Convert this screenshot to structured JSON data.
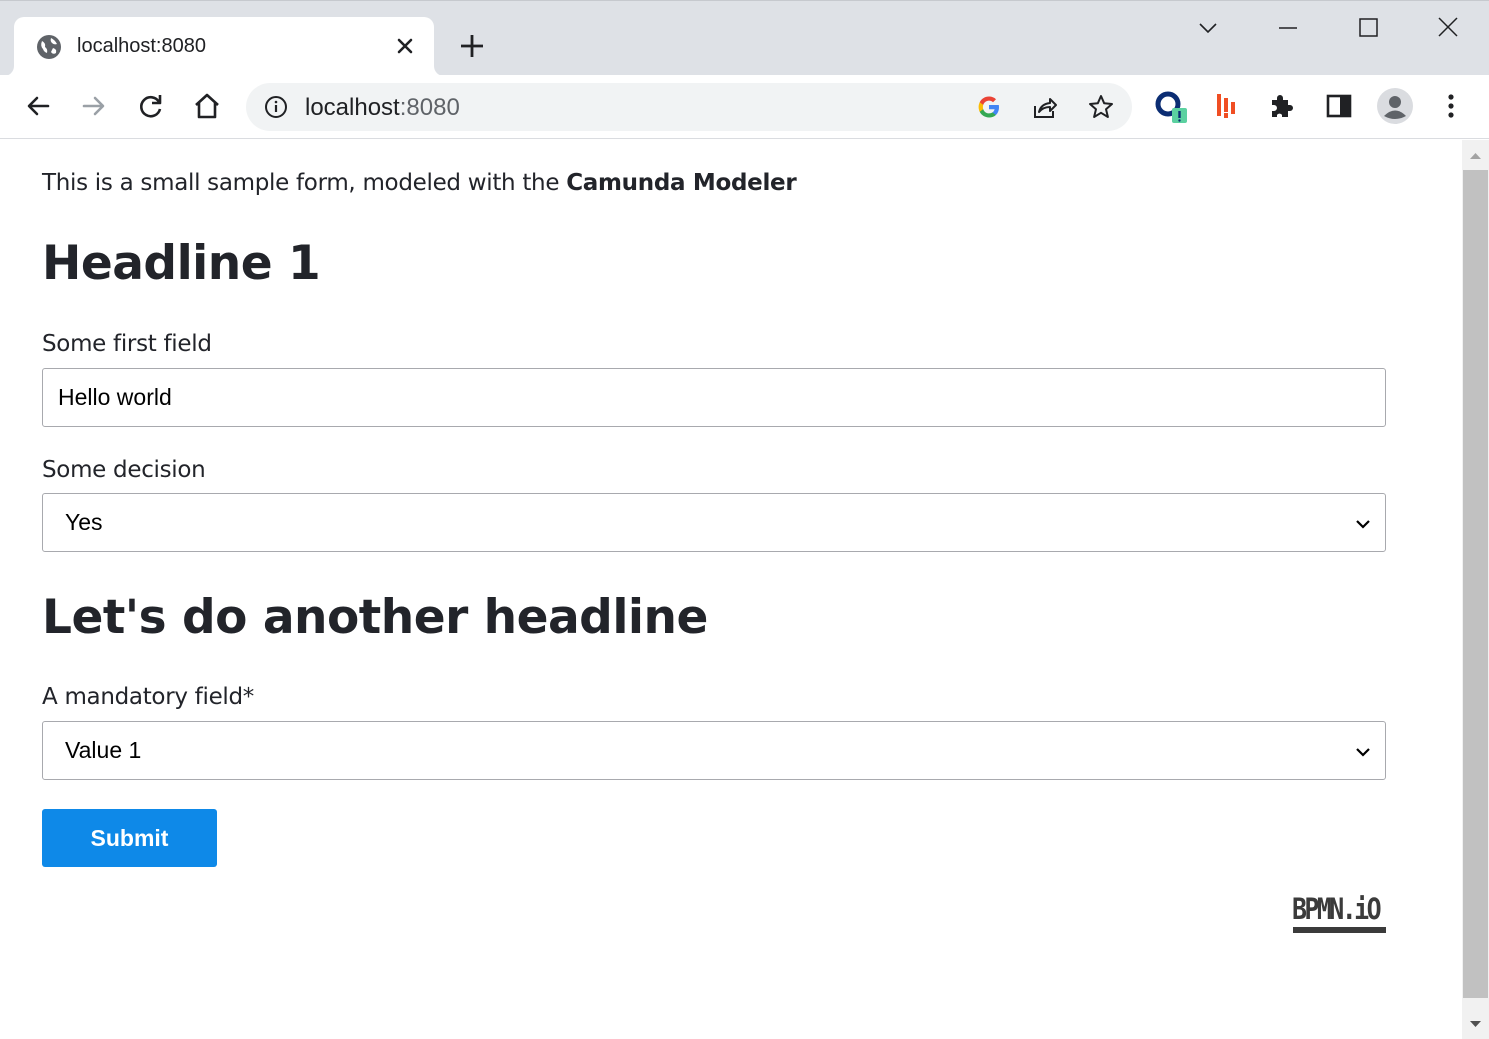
{
  "browser": {
    "tab": {
      "title": "localhost:8080",
      "favicon": "globe-icon"
    },
    "address": {
      "host": "localhost",
      "port": ":8080"
    },
    "icons": {
      "back": "arrow-left-icon",
      "forward": "arrow-right-icon",
      "reload": "reload-icon",
      "home": "home-icon",
      "google": "google-icon",
      "share": "share-icon",
      "bookmark": "star-icon",
      "extensions": "puzzle-icon",
      "sidepanel": "side-panel-icon",
      "profile": "profile-icon",
      "menu": "kebab-menu-icon"
    }
  },
  "form": {
    "intro_prefix": "This is a small sample form, modeled with the ",
    "intro_bold": "Camunda Modeler",
    "headline1": "Headline 1",
    "field1": {
      "label": "Some first field",
      "value": "Hello world"
    },
    "field2": {
      "label": "Some decision",
      "value": "Yes"
    },
    "headline2": "Let's do another headline",
    "field3": {
      "label": "A mandatory field*",
      "value": "Value 1"
    },
    "submit_label": "Submit",
    "powered_by": "BPMN.iO"
  },
  "colors": {
    "accent": "#0e89e8",
    "text": "#22242a",
    "border": "#a8a9ae",
    "tabstrip": "#dee1e6"
  }
}
